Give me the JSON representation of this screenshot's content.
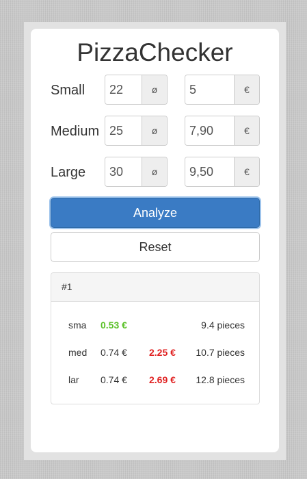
{
  "app": {
    "title": "PizzaChecker"
  },
  "sizes": [
    {
      "label": "Small",
      "diameter": "22",
      "diameter_unit": "ø",
      "price": "5",
      "currency": "€"
    },
    {
      "label": "Medium",
      "diameter": "25",
      "diameter_unit": "ø",
      "price": "7,90",
      "currency": "€"
    },
    {
      "label": "Large",
      "diameter": "30",
      "diameter_unit": "ø",
      "price": "9,50",
      "currency": "€"
    }
  ],
  "buttons": {
    "analyze": "Analyze",
    "reset": "Reset"
  },
  "results": {
    "heading": "#1",
    "rows": [
      {
        "name": "sma",
        "price1": "0.53 €",
        "price1_status": "best",
        "price2": "",
        "pieces": "9.4 pieces"
      },
      {
        "name": "med",
        "price1": "0.74 €",
        "price2": "2.25 €",
        "price2_status": "worse",
        "pieces": "10.7 pieces"
      },
      {
        "name": "lar",
        "price1": "0.74 €",
        "price2": "2.69 €",
        "price2_status": "worse",
        "pieces": "12.8 pieces"
      }
    ]
  },
  "colors": {
    "primary": "#3a7bc4",
    "best": "#5cc12a",
    "worse": "#e02020"
  }
}
